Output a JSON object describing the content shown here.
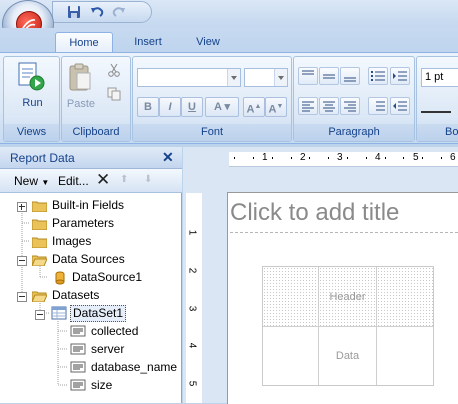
{
  "ribbon": {
    "tabs": [
      "Home",
      "Insert",
      "View"
    ],
    "views_group": {
      "run_label": "Run",
      "label": "Views"
    },
    "clipboard_group": {
      "paste_label": "Paste",
      "label": "Clipboard"
    },
    "font_group": {
      "label": "Font"
    },
    "paragraph_group": {
      "label": "Paragraph"
    },
    "border_group": {
      "label": "Bo",
      "width_value": "1 pt"
    }
  },
  "report_data": {
    "title": "Report Data",
    "toolbar": {
      "new_label": "New",
      "edit_label": "Edit..."
    },
    "tree": {
      "built_in_fields": "Built-in Fields",
      "parameters": "Parameters",
      "images": "Images",
      "data_sources": "Data Sources",
      "data_source_1": "DataSource1",
      "datasets": "Datasets",
      "dataset_1": "DataSet1",
      "fields": [
        "collected",
        "server",
        "database_name",
        "size"
      ]
    }
  },
  "design": {
    "ruler_numbers": [
      "1",
      "2",
      "3",
      "4",
      "5",
      "6"
    ],
    "vruler_numbers": [
      "1",
      "2",
      "3",
      "4",
      "5"
    ],
    "title_placeholder": "Click to add title",
    "table": {
      "header": "Header",
      "data": "Data"
    }
  }
}
